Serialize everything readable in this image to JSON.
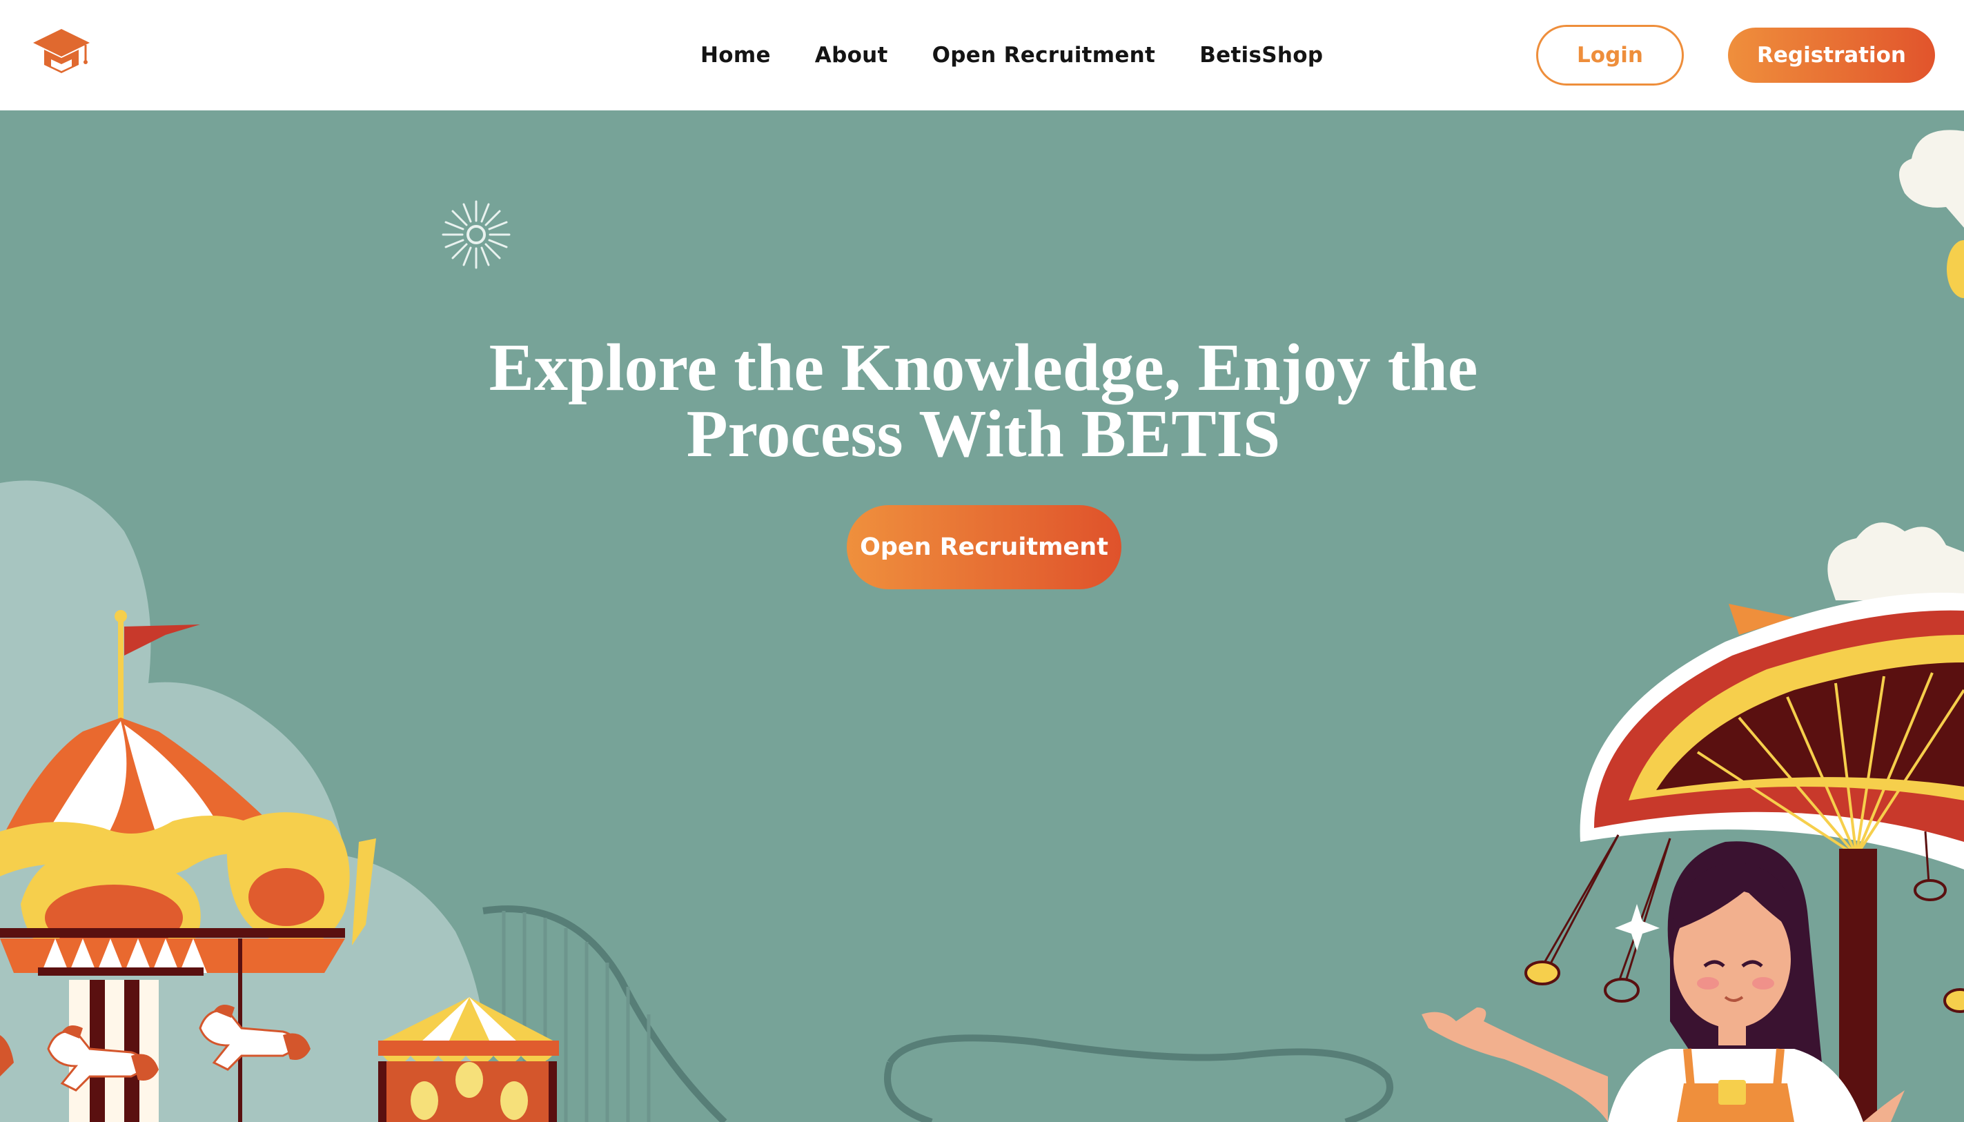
{
  "nav": {
    "logo_icon": "graduation-cap-icon",
    "links": [
      "Home",
      "About",
      "Open Recruitment",
      "BetisShop"
    ],
    "login_label": "Login",
    "register_label": "Registration"
  },
  "hero": {
    "title_line1": "Explore the Knowledge, Enjoy the",
    "title_line2": "Process With BETIS",
    "cta_label": "Open Recruitment"
  },
  "colors": {
    "hero_bg": "#77a398",
    "accent_orange": "#ef8f3c",
    "accent_red": "#e1542c",
    "dark_maroon": "#5a1010",
    "yellow": "#f6cf4c"
  }
}
